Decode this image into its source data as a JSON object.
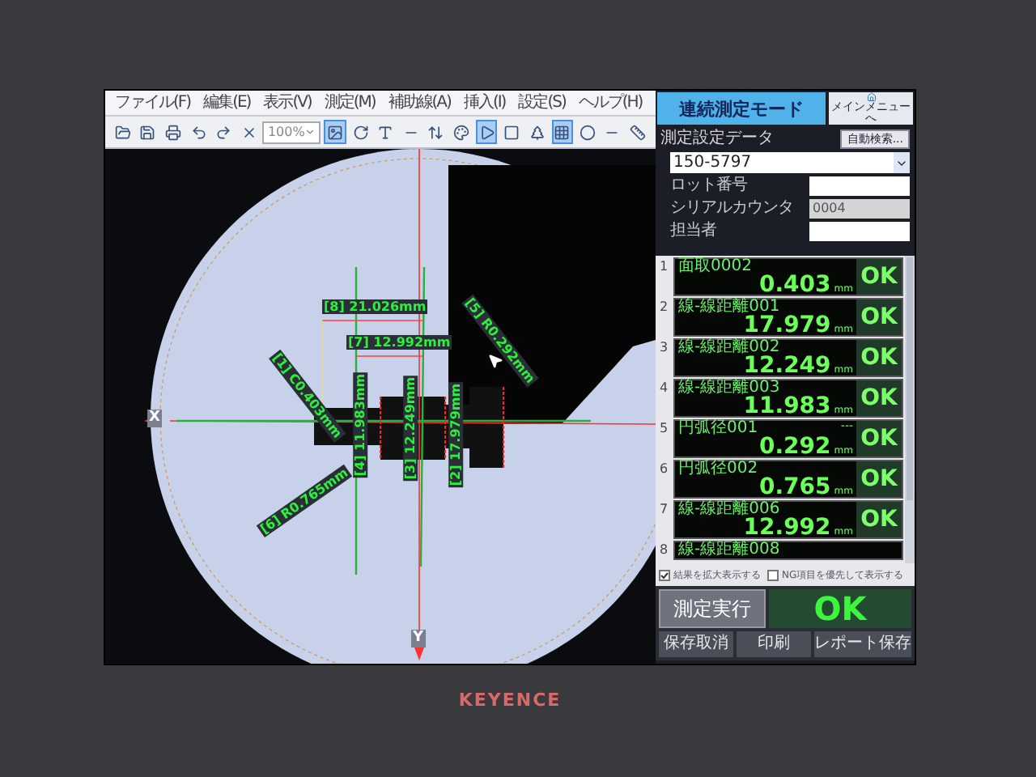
{
  "menu": [
    "ファイル(F)",
    "編集(E)",
    "表示(V)",
    "測定(M)",
    "補助線(A)",
    "挿入(I)",
    "設定(S)",
    "ヘルプ(H)"
  ],
  "toolbar": {
    "zoom": "100%",
    "tools": [
      {
        "kind": "open",
        "selected": false
      },
      {
        "kind": "save",
        "selected": false
      },
      {
        "kind": "print",
        "selected": false
      },
      {
        "kind": "undo",
        "selected": false
      },
      {
        "kind": "redo",
        "selected": false
      },
      {
        "kind": "delete",
        "selected": false
      },
      {
        "kind": "zoom-select",
        "selected": false
      },
      {
        "kind": "image",
        "selected": true
      },
      {
        "kind": "rotate",
        "selected": false
      },
      {
        "kind": "text",
        "selected": false
      },
      {
        "kind": "flat",
        "selected": false
      },
      {
        "kind": "height",
        "selected": false
      },
      {
        "kind": "color",
        "selected": false
      },
      {
        "kind": "play",
        "selected": true
      },
      {
        "kind": "stop",
        "selected": false
      },
      {
        "kind": "tree",
        "selected": false
      },
      {
        "kind": "grid",
        "selected": true
      },
      {
        "kind": "circle",
        "selected": false
      },
      {
        "kind": "line",
        "selected": false
      },
      {
        "kind": "ruler",
        "selected": false
      }
    ]
  },
  "camera": {
    "axis_x": "X",
    "axis_y": "Y",
    "annotations": [
      {
        "text": "[8] 21.026mm"
      },
      {
        "text": "[7] 12.992mm"
      },
      {
        "text": "[1] C0.403mm"
      },
      {
        "text": "[4] 11.983mm"
      },
      {
        "text": "[3] 12.249mm"
      },
      {
        "text": "[5] R0.292mm"
      },
      {
        "text": "[2] 17.979mm"
      },
      {
        "text": "[6] R0.765mm"
      }
    ]
  },
  "panel": {
    "title": "連続測定モード",
    "main_menu_button": "メインメニューへ",
    "settings_label": "測定設定データ",
    "auto_search_button": "自動検索...",
    "setting_value": "150-5797",
    "fields": [
      {
        "label": "ロット番号",
        "disabled": false
      },
      {
        "label": "シリアルカウンタ",
        "value": "0004",
        "disabled": true
      },
      {
        "label": "担当者",
        "disabled": false
      }
    ],
    "results": [
      {
        "index": "1",
        "name": "面取0002",
        "value": "0.403",
        "unit": "mm",
        "judgment": "OK"
      },
      {
        "index": "2",
        "name": "線-線距離001",
        "value": "17.979",
        "unit": "mm",
        "judgment": "OK"
      },
      {
        "index": "3",
        "name": "線-線距離002",
        "value": "12.249",
        "unit": "mm",
        "judgment": "OK"
      },
      {
        "index": "4",
        "name": "線-線距離003",
        "value": "11.983",
        "unit": "mm",
        "judgment": "OK"
      },
      {
        "index": "5",
        "name": "円弧径001",
        "note": "---",
        "value": "0.292",
        "unit": "mm",
        "judgment": "OK"
      },
      {
        "index": "6",
        "name": "円弧径002",
        "value": "0.765",
        "unit": "mm",
        "judgment": "OK"
      },
      {
        "index": "7",
        "name": "線-線距離006",
        "value": "12.992",
        "unit": "mm",
        "judgment": "OK"
      },
      {
        "index": "8",
        "name": "線-線距離008"
      }
    ],
    "options": [
      {
        "label": "結果を拡大表示する",
        "checked": true
      },
      {
        "label": "NG項目を優先して表示する",
        "checked": false
      }
    ],
    "run_button": "測定実行",
    "overall": "OK",
    "bottom_buttons": [
      "保存取消",
      "印刷",
      "レポート保存"
    ]
  },
  "bezel": {
    "logo": "KEYENCE"
  }
}
